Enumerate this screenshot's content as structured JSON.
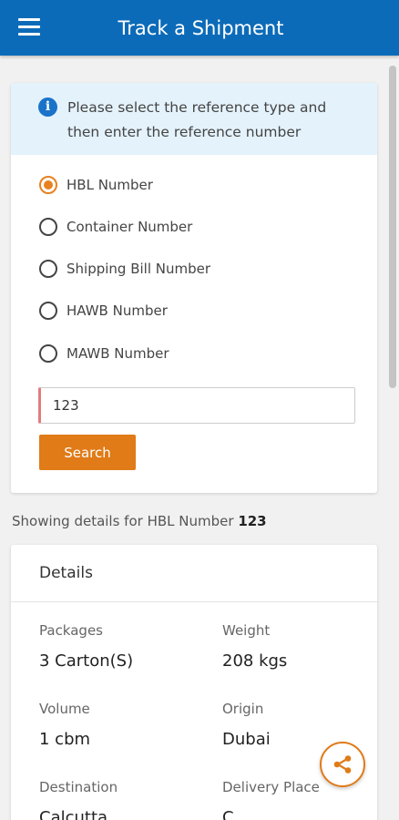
{
  "appbar": {
    "title": "Track a Shipment"
  },
  "info": {
    "text": "Please select the reference type and then enter the reference number"
  },
  "reference_types": [
    {
      "label": "HBL Number",
      "selected": true
    },
    {
      "label": "Container Number",
      "selected": false
    },
    {
      "label": "Shipping Bill Number",
      "selected": false
    },
    {
      "label": "HAWB Number",
      "selected": false
    },
    {
      "label": "MAWB Number",
      "selected": false
    }
  ],
  "search": {
    "value": "123",
    "button_label": "Search"
  },
  "result": {
    "prefix": "Showing details for HBL Number",
    "ref": "123"
  },
  "details": {
    "title": "Details",
    "packages_label": "Packages",
    "packages_value": "3 Carton(S)",
    "weight_label": "Weight",
    "weight_value": "208 kgs",
    "volume_label": "Volume",
    "volume_value": "1 cbm",
    "origin_label": "Origin",
    "origin_value": "Dubai",
    "destination_label": "Destination",
    "destination_value": "Calcutta",
    "delivery_label": "Delivery Place",
    "delivery_value": "C"
  },
  "icons": {
    "menu": "menu-icon",
    "info": "info-icon",
    "share": "share-icon"
  },
  "colors": {
    "appbar": "#0c6bb8",
    "accent": "#e07b18",
    "info_bg": "#e4f2fc"
  }
}
